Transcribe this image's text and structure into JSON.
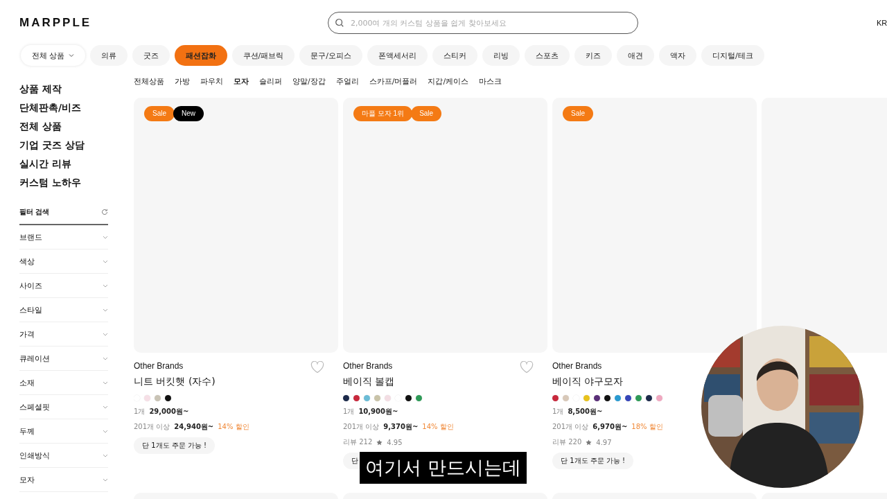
{
  "header": {
    "logo": "MARPPLE",
    "search": {
      "placeholder": "2,000여 개의 커스텀 상품을 쉽게 찾아보세요"
    },
    "language": "KR"
  },
  "categories": [
    {
      "label": "전체 상품",
      "kind": "dropdown",
      "selected": false
    },
    {
      "label": "의류",
      "kind": "pill",
      "selected": false
    },
    {
      "label": "굿즈",
      "kind": "pill",
      "selected": false
    },
    {
      "label": "패션잡화",
      "kind": "pill",
      "selected": true
    },
    {
      "label": "쿠션/패브릭",
      "kind": "pill",
      "selected": false
    },
    {
      "label": "문구/오피스",
      "kind": "pill",
      "selected": false
    },
    {
      "label": "폰액세서리",
      "kind": "pill",
      "selected": false
    },
    {
      "label": "스티커",
      "kind": "pill",
      "selected": false
    },
    {
      "label": "리빙",
      "kind": "pill",
      "selected": false
    },
    {
      "label": "스포츠",
      "kind": "pill",
      "selected": false
    },
    {
      "label": "키즈",
      "kind": "pill",
      "selected": false
    },
    {
      "label": "애견",
      "kind": "pill",
      "selected": false
    },
    {
      "label": "액자",
      "kind": "pill",
      "selected": false
    },
    {
      "label": "디지털/테크",
      "kind": "pill",
      "selected": false
    }
  ],
  "subcategories": [
    {
      "label": "전체상품",
      "selected": false
    },
    {
      "label": "가방",
      "selected": false
    },
    {
      "label": "파우치",
      "selected": false
    },
    {
      "label": "모자",
      "selected": true
    },
    {
      "label": "슬리퍼",
      "selected": false
    },
    {
      "label": "양말/장갑",
      "selected": false
    },
    {
      "label": "주얼리",
      "selected": false
    },
    {
      "label": "스카프/머플러",
      "selected": false
    },
    {
      "label": "지갑/케이스",
      "selected": false
    },
    {
      "label": "마스크",
      "selected": false
    }
  ],
  "sidebar": {
    "links": [
      "상품 제작",
      "단체판촉/비즈",
      "전체 상품",
      "기업 굿즈 상담",
      "실시간 리뷰",
      "커스텀 노하우"
    ],
    "filter_title": "필터 검색",
    "filters": [
      "브랜드",
      "색상",
      "사이즈",
      "스타일",
      "가격",
      "큐레이션",
      "소재",
      "스페셜핏",
      "두께",
      "인쇄방식",
      "모자"
    ]
  },
  "products": [
    {
      "kind": "product",
      "badges": [
        {
          "label": "Sale",
          "color": "#f47a14"
        },
        {
          "label": "New",
          "color": "#000000"
        }
      ],
      "heart": true,
      "brand": "Other Brands",
      "name": "니트 버킷햇 (자수)",
      "colors": [
        {
          "color": "#ffffff"
        },
        {
          "color": "#f6dfe6"
        },
        {
          "color": "#c9c3b5"
        },
        {
          "color": "#111111"
        }
      ],
      "unit_label": "1개",
      "unit_price": "29,000원~",
      "bulk_label": "201개 이상",
      "bulk_price": "24,940원~",
      "discount": "14% 할인",
      "notice": "단 1개도 주문 가능 !"
    },
    {
      "kind": "product",
      "badges": [
        {
          "label": "마플 모자 1위",
          "color": "#f47a14"
        },
        {
          "label": "Sale",
          "color": "#f47a14"
        }
      ],
      "heart": true,
      "brand": "Other Brands",
      "name": "베이직 볼캡",
      "colors": [
        {
          "color": "#1c2a4a"
        },
        {
          "color": "#c8283c"
        },
        {
          "color": "#6bbcd6"
        },
        {
          "color": "#c9c3a8"
        },
        {
          "color": "#f3dde3"
        },
        {
          "color": "#ffffff"
        },
        {
          "color": "#111111"
        },
        {
          "color": "#2e9a57"
        }
      ],
      "unit_label": "1개",
      "unit_price": "10,900원~",
      "bulk_label": "201개 이상",
      "bulk_price": "9,370원~",
      "discount": "14% 할인",
      "reviews": "리뷰 212",
      "rating": "4.95",
      "notice": "단"
    },
    {
      "kind": "product",
      "badges": [
        {
          "label": "Sale",
          "color": "#f47a14"
        }
      ],
      "heart": false,
      "brand": "Other Brands",
      "name": "베이직 야구모자",
      "colors": [
        {
          "color": "#c8283c"
        },
        {
          "color": "#d8c8b8"
        },
        {
          "color": "#ffffff"
        },
        {
          "color": "#e8c21c"
        },
        {
          "color": "#5a2f78"
        },
        {
          "color": "#111111"
        },
        {
          "color": "#2a9ad0"
        },
        {
          "color": "#3646b8"
        },
        {
          "color": "#2e9a57"
        },
        {
          "color": "#1c2a4a"
        },
        {
          "color": "#f0a8c0"
        }
      ],
      "unit_label": "1개",
      "unit_price": "8,500원~",
      "bulk_label": "201개 이상",
      "bulk_price": "6,970원~",
      "discount": "18% 할인",
      "reviews": "리뷰 220",
      "rating": "4.97",
      "notice": "단 1개도 주문 가능 !"
    },
    {
      "kind": "image_only"
    }
  ],
  "video_overlay": {
    "kind": "picture",
    "subtitle": "여기서 만드시는데"
  }
}
